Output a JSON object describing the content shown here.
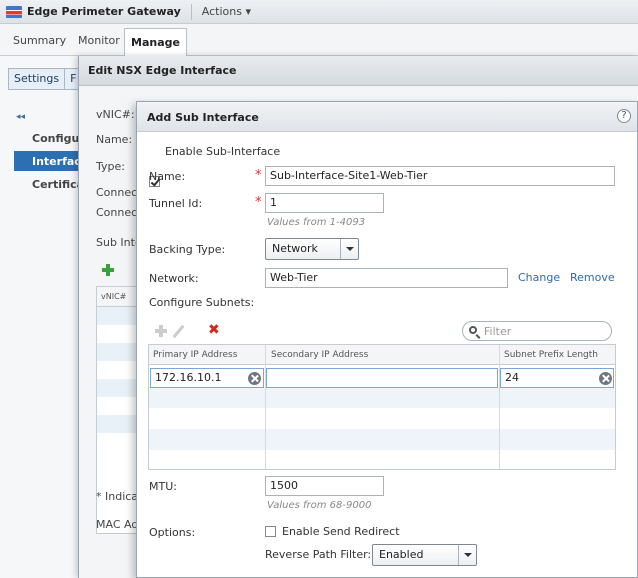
{
  "header": {
    "title": "Edge Perimeter Gateway",
    "actions_label": "Actions ▾"
  },
  "main_tabs": [
    {
      "label": "Summary"
    },
    {
      "label": "Monitor"
    },
    {
      "label": "Manage"
    }
  ],
  "sub_tabs": [
    {
      "label": "Settings"
    },
    {
      "label": "F"
    }
  ],
  "left_nav": {
    "collapse_label": "◂◂",
    "items": [
      {
        "label": "Configur"
      },
      {
        "label": "Interface"
      },
      {
        "label": "Certifica"
      }
    ]
  },
  "edit_dialog": {
    "title": "Edit NSX Edge Interface",
    "vnic_label": "vNIC#:",
    "name_label": "Name:",
    "type_label": "Type:",
    "connect_label_1": "Connec",
    "connect_label_2": "Connec",
    "sub_int_label": "Sub Inte",
    "table_header": "vNIC#",
    "indicates_label": "* Indica",
    "mac_label": "MAC Ad"
  },
  "sub_dialog": {
    "title": "Add Sub Interface",
    "help_label": "?",
    "enable_label": "Enable Sub-Interface",
    "name_label": "Name:",
    "name_value": "Sub-Interface-Site1-Web-Tier",
    "tunnel_label": "Tunnel Id:",
    "tunnel_value": "1",
    "tunnel_hint": "Values from 1-4093",
    "backing_label": "Backing Type:",
    "backing_value": "Network",
    "network_label": "Network:",
    "network_value": "Web-Tier",
    "change_label": "Change",
    "remove_label": "Remove",
    "subnets_label": "Configure Subnets:",
    "filter_placeholder": "Filter",
    "columns": [
      "Primary IP Address",
      "Secondary IP Address",
      "Subnet Prefix Length"
    ],
    "row": {
      "primary_ip": "172.16.10.1",
      "secondary_ip": "",
      "prefix": "24"
    },
    "mtu_label": "MTU:",
    "mtu_value": "1500",
    "mtu_hint": "Values from 68-9000",
    "options_label": "Options:",
    "send_redirect_label": "Enable Send Redirect",
    "rpf_label": "Reverse Path Filter:",
    "rpf_value": "Enabled",
    "required_mark": "*"
  },
  "colors": {
    "accent": "#2c6fb3",
    "required": "#e0302a",
    "delete": "#d9251c",
    "add": "#3aa13a"
  }
}
